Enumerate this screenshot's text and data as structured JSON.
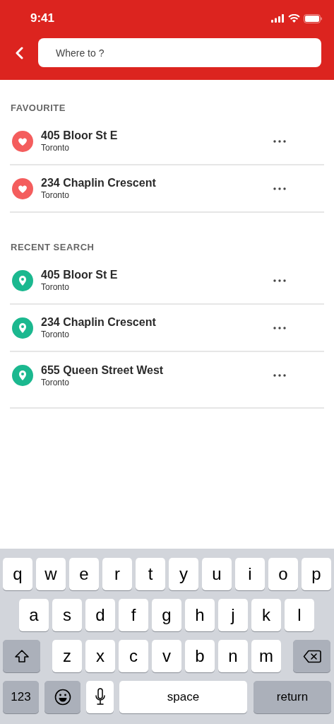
{
  "status_bar": {
    "time": "9:41"
  },
  "search": {
    "placeholder": "Where to ?"
  },
  "sections": [
    {
      "title": "FAVOURITE",
      "items": [
        {
          "kind": "favourite",
          "title": "405 Bloor St E",
          "subtitle": "Toronto"
        },
        {
          "kind": "favourite",
          "title": "234 Chaplin Crescent",
          "subtitle": "Toronto"
        }
      ]
    },
    {
      "title": "RECENT SEARCH",
      "items": [
        {
          "kind": "recent",
          "title": "405 Bloor St E",
          "subtitle": "Toronto"
        },
        {
          "kind": "recent",
          "title": "234 Chaplin Crescent",
          "subtitle": "Toronto"
        },
        {
          "kind": "recent",
          "title": "655 Queen Street West",
          "subtitle": "Toronto"
        }
      ]
    }
  ],
  "keyboard": {
    "top_letters": [
      "q",
      "w",
      "e",
      "r",
      "t",
      "y",
      "u",
      "i",
      "o",
      "p"
    ],
    "middle_letters": [
      "a",
      "s",
      "d",
      "f",
      "g",
      "h",
      "j",
      "k",
      "l"
    ],
    "bottom_letters": [
      "z",
      "x",
      "c",
      "v",
      "b",
      "n",
      "m"
    ],
    "numbers_key": "123",
    "space_key": "space",
    "return_key": "return"
  }
}
